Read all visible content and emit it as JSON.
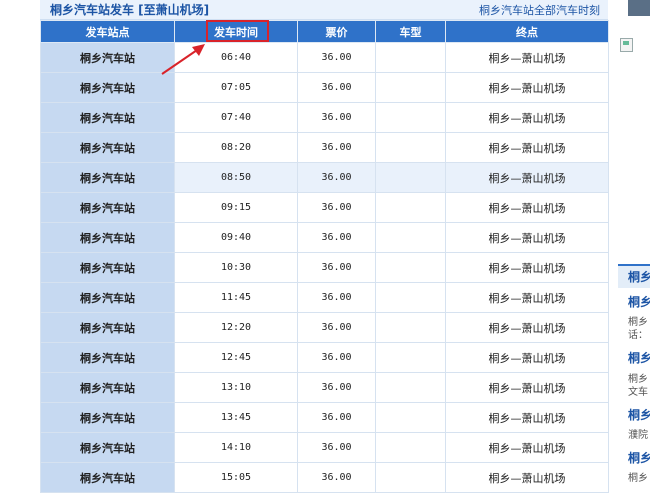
{
  "header": {
    "title": "桐乡汽车站发车 [至萧山机场]",
    "all_link": "桐乡汽车站全部汽车时刻"
  },
  "table": {
    "columns": [
      "发车站点",
      "发车时间",
      "票价",
      "车型",
      "终点"
    ],
    "rows": [
      {
        "station": "桐乡汽车站",
        "time": "06:40",
        "price": "36.00",
        "type": "",
        "dest": "桐乡—萧山机场"
      },
      {
        "station": "桐乡汽车站",
        "time": "07:05",
        "price": "36.00",
        "type": "",
        "dest": "桐乡—萧山机场"
      },
      {
        "station": "桐乡汽车站",
        "time": "07:40",
        "price": "36.00",
        "type": "",
        "dest": "桐乡—萧山机场"
      },
      {
        "station": "桐乡汽车站",
        "time": "08:20",
        "price": "36.00",
        "type": "",
        "dest": "桐乡—萧山机场"
      },
      {
        "station": "桐乡汽车站",
        "time": "08:50",
        "price": "36.00",
        "type": "",
        "dest": "桐乡—萧山机场"
      },
      {
        "station": "桐乡汽车站",
        "time": "09:15",
        "price": "36.00",
        "type": "",
        "dest": "桐乡—萧山机场"
      },
      {
        "station": "桐乡汽车站",
        "time": "09:40",
        "price": "36.00",
        "type": "",
        "dest": "桐乡—萧山机场"
      },
      {
        "station": "桐乡汽车站",
        "time": "10:30",
        "price": "36.00",
        "type": "",
        "dest": "桐乡—萧山机场"
      },
      {
        "station": "桐乡汽车站",
        "time": "11:45",
        "price": "36.00",
        "type": "",
        "dest": "桐乡—萧山机场"
      },
      {
        "station": "桐乡汽车站",
        "time": "12:20",
        "price": "36.00",
        "type": "",
        "dest": "桐乡—萧山机场"
      },
      {
        "station": "桐乡汽车站",
        "time": "12:45",
        "price": "36.00",
        "type": "",
        "dest": "桐乡—萧山机场"
      },
      {
        "station": "桐乡汽车站",
        "time": "13:10",
        "price": "36.00",
        "type": "",
        "dest": "桐乡—萧山机场"
      },
      {
        "station": "桐乡汽车站",
        "time": "13:45",
        "price": "36.00",
        "type": "",
        "dest": "桐乡—萧山机场"
      },
      {
        "station": "桐乡汽车站",
        "time": "14:10",
        "price": "36.00",
        "type": "",
        "dest": "桐乡—萧山机场"
      },
      {
        "station": "桐乡汽车站",
        "time": "15:05",
        "price": "36.00",
        "type": "",
        "dest": "桐乡—萧山机场"
      }
    ],
    "highlighted_row": 4
  },
  "annotation": {
    "highlight_column": "发车时间",
    "color": "#d9232a"
  },
  "sidebar": {
    "heading": "桐乡",
    "links": [
      "桐乡",
      "桐乡",
      "桐乡",
      "桐乡"
    ],
    "descs": [
      "桐乡",
      "话：",
      "桐乡",
      "文车",
      "濮院",
      "桐乡"
    ]
  }
}
